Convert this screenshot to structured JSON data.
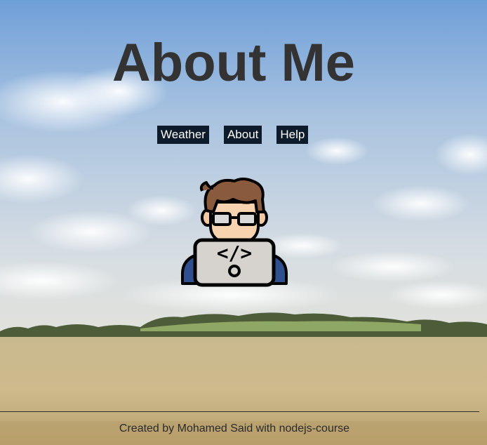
{
  "page": {
    "title": "About Me"
  },
  "nav": {
    "items": [
      {
        "label": "Weather"
      },
      {
        "label": "About"
      },
      {
        "label": "Help"
      }
    ]
  },
  "avatar": {
    "icon": "developer-avatar-icon",
    "code_glyph": "</>"
  },
  "footer": {
    "text": "Created by Mohamed Said with nodejs-course"
  },
  "colors": {
    "title": "#333333",
    "nav_bg": "#0e1b2a",
    "nav_text": "#ffffff",
    "footer_text": "#2a2a2a"
  }
}
